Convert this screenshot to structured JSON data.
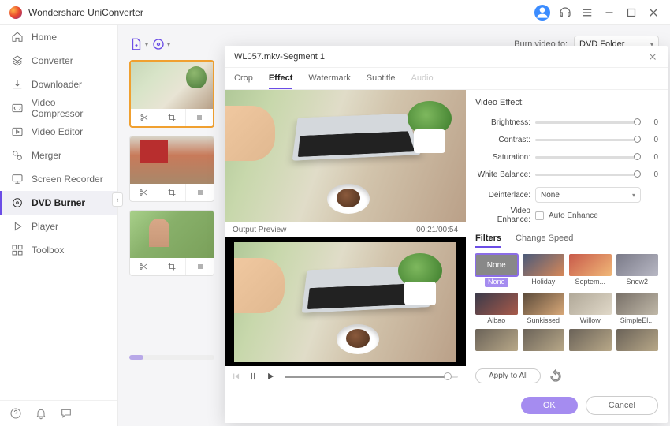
{
  "app": {
    "title": "Wondershare UniConverter"
  },
  "sidebar": {
    "items": [
      {
        "label": "Home"
      },
      {
        "label": "Converter"
      },
      {
        "label": "Downloader"
      },
      {
        "label": "Video Compressor"
      },
      {
        "label": "Video Editor"
      },
      {
        "label": "Merger"
      },
      {
        "label": "Screen Recorder"
      },
      {
        "label": "DVD Burner"
      },
      {
        "label": "Player"
      },
      {
        "label": "Toolbox"
      }
    ],
    "active_index": 7
  },
  "burn": {
    "label": "Burn video to:",
    "target": "DVD Folder"
  },
  "editor": {
    "title": "WL057.mkv-Segment 1",
    "tabs": [
      "Crop",
      "Effect",
      "Watermark",
      "Subtitle",
      "Audio"
    ],
    "active_tab": 1,
    "disabled_tab": 4,
    "output_label": "Output Preview",
    "timestamp": "00:21/00:54",
    "ve_title": "Video Effect:",
    "brightness": {
      "label": "Brightness:",
      "value": "0"
    },
    "contrast": {
      "label": "Contrast:",
      "value": "0"
    },
    "saturation": {
      "label": "Saturation:",
      "value": "0"
    },
    "whitebalance": {
      "label": "White Balance:",
      "value": "0"
    },
    "deinterlace": {
      "label": "Deinterlace:",
      "value": "None"
    },
    "enhance": {
      "label": "Video Enhance:",
      "checkbox": "Auto Enhance"
    },
    "sub_tabs": [
      "Filters",
      "Change Speed"
    ],
    "active_sub": 0,
    "filters": [
      {
        "name": "None",
        "cls": "ft-none"
      },
      {
        "name": "Holiday",
        "cls": "ft-holi"
      },
      {
        "name": "Septem...",
        "cls": "ft-sept"
      },
      {
        "name": "Snow2",
        "cls": "ft-snow"
      },
      {
        "name": "Aibao",
        "cls": "ft-aibao"
      },
      {
        "name": "Sunkissed",
        "cls": "ft-sunk"
      },
      {
        "name": "Willow",
        "cls": "ft-wil"
      },
      {
        "name": "SimpleEl...",
        "cls": "ft-simp"
      },
      {
        "name": "",
        "cls": "ft-gen"
      },
      {
        "name": "",
        "cls": "ft-gen"
      },
      {
        "name": "",
        "cls": "ft-gen"
      },
      {
        "name": "",
        "cls": "ft-gen"
      }
    ],
    "selected_filter": 0,
    "apply_all": "Apply to All",
    "ok": "OK",
    "cancel": "Cancel"
  }
}
